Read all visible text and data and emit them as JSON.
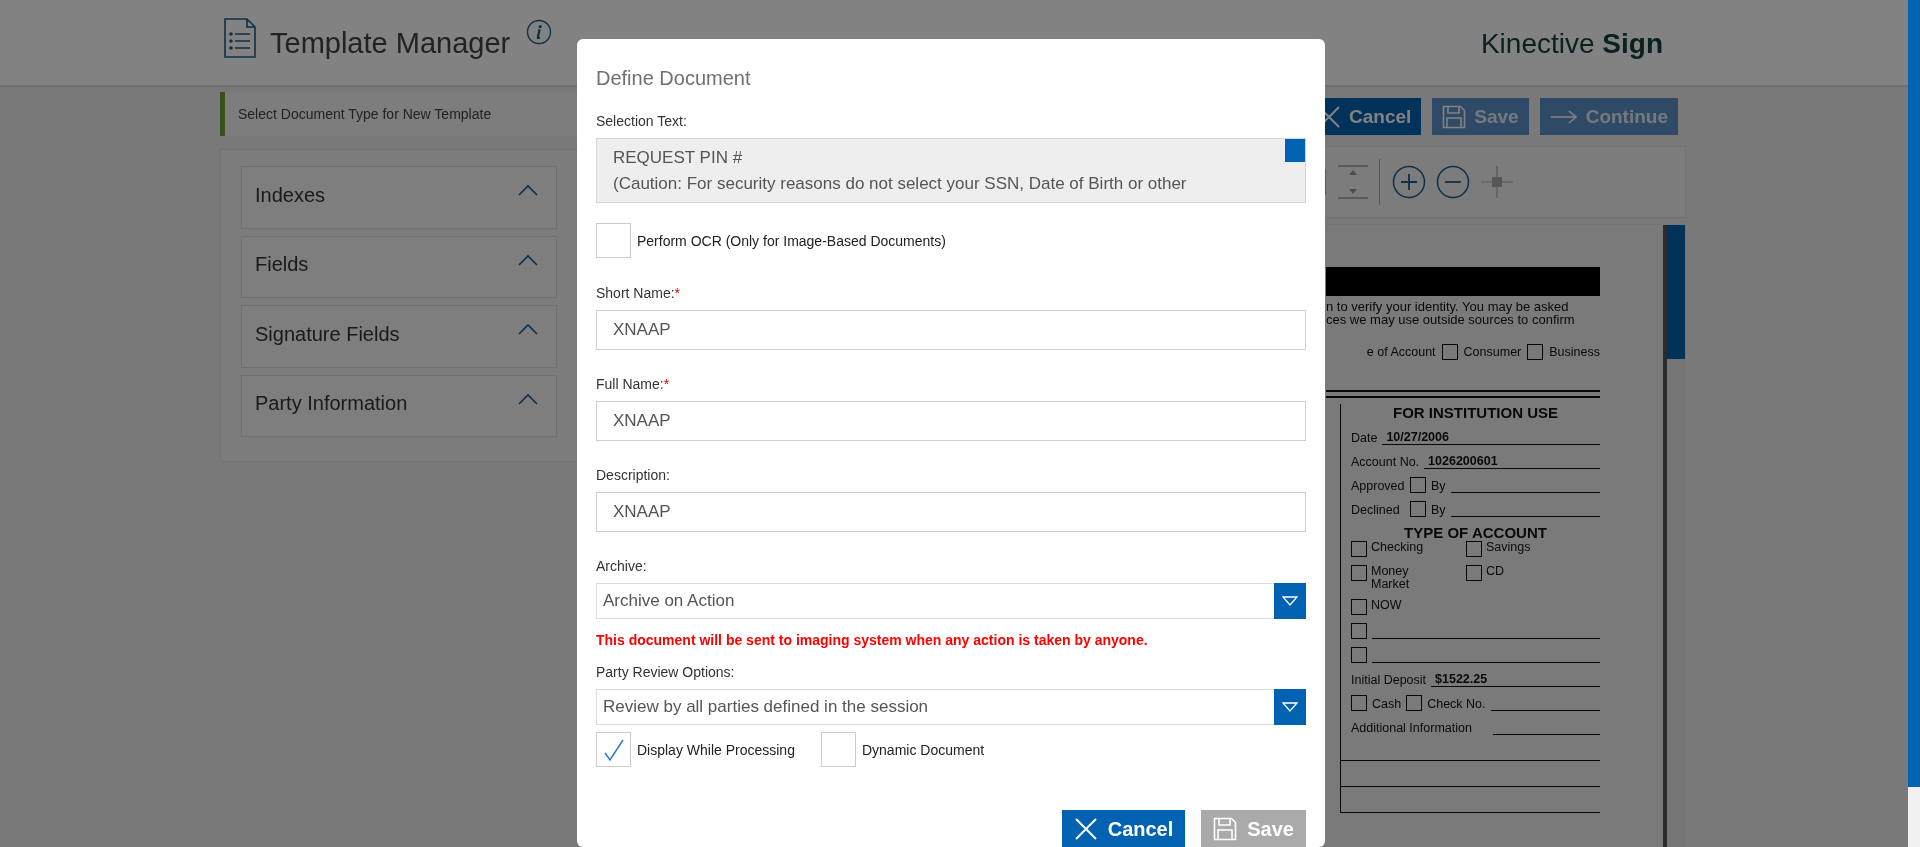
{
  "header": {
    "title": "Template Manager",
    "brand_light": "Kinective",
    "brand_bold": "Sign"
  },
  "subheader": "Select Document Type for New Template",
  "actions": [
    {
      "label": "Cancel",
      "kind": "cancel",
      "disabled": false
    },
    {
      "label": "Save",
      "kind": "save",
      "disabled": true
    },
    {
      "label": "Continue",
      "kind": "continue",
      "disabled": true
    }
  ],
  "sections": [
    {
      "label": "Indexes",
      "expanded": true
    },
    {
      "label": "Fields",
      "expanded": true
    },
    {
      "label": "Signature Fields",
      "expanded": true
    },
    {
      "label": "Party Information",
      "expanded": true
    }
  ],
  "document": {
    "intro_lines": [
      "n to verify your identity. You may be asked",
      "ces we may use outside sources to confirm"
    ],
    "account_type": {
      "label": "e of Account",
      "options": [
        {
          "label": "Consumer",
          "checked": false
        },
        {
          "label": "Business",
          "checked": false
        }
      ]
    },
    "institution": {
      "title": "FOR INSTITUTION USE",
      "rows": [
        {
          "kind": "value",
          "label": "Date",
          "value": "10/27/2006"
        },
        {
          "kind": "value",
          "label": "Account No.",
          "value": "1026200601"
        },
        {
          "kind": "check_by",
          "label": "Approved",
          "by": "By",
          "checked": false
        },
        {
          "kind": "check_by",
          "label": "Declined",
          "by": "By",
          "checked": false
        },
        {
          "kind": "heading",
          "label": "TYPE OF ACCOUNT"
        },
        {
          "kind": "pair",
          "options": [
            {
              "label": "Checking",
              "checked": false
            },
            {
              "label": "Savings",
              "checked": false
            }
          ]
        },
        {
          "kind": "pair",
          "options": [
            {
              "label": "Money Market",
              "checked": false
            },
            {
              "label": "CD",
              "checked": false
            }
          ]
        },
        {
          "kind": "option",
          "label": "NOW",
          "checked": false
        },
        {
          "kind": "blank",
          "checked": false
        },
        {
          "kind": "blank",
          "checked": false
        },
        {
          "kind": "value",
          "label": "Initial Deposit",
          "value": "$1522.25"
        },
        {
          "kind": "checks",
          "options": [
            {
              "label": "Cash",
              "checked": false
            },
            {
              "label": "Check No.",
              "checked": false
            }
          ]
        },
        {
          "kind": "line",
          "label": "Additional Information"
        },
        {
          "kind": "rule"
        },
        {
          "kind": "rule"
        },
        {
          "kind": "rule"
        }
      ]
    }
  },
  "dialog": {
    "title": "Define Document",
    "selection_text": {
      "label": "Selection Text:",
      "lines": [
        "REQUEST PIN #",
        "(Caution: For security reasons do not select your SSN, Date of Birth or other"
      ]
    },
    "ocr": {
      "label": "Perform OCR (Only for Image-Based Documents)",
      "checked": false
    },
    "fields": [
      {
        "label": "Short Name:",
        "required_mark": "*",
        "value": "XNAAP"
      },
      {
        "label": "Full Name:",
        "required_mark": "*",
        "value": "XNAAP"
      },
      {
        "label": "Description:",
        "value": "XNAAP"
      }
    ],
    "archive": {
      "label": "Archive:",
      "value": "Archive on Action"
    },
    "archive_note": "This document will be sent to imaging system when any action is taken by anyone.",
    "party_review": {
      "label": "Party Review Options:",
      "value": "Review by all parties defined in the session"
    },
    "options": [
      {
        "label": "Display While Processing",
        "checked": true
      },
      {
        "label": "Dynamic Document",
        "checked": false
      }
    ],
    "buttons": [
      {
        "label": "Cancel",
        "kind": "cancel",
        "disabled": false
      },
      {
        "label": "Save",
        "kind": "save",
        "disabled": true
      }
    ]
  }
}
